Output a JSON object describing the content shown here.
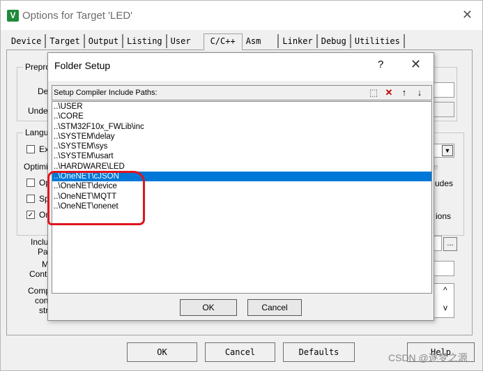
{
  "window": {
    "title": "Options for Target 'LED'",
    "close_glyph": "✕"
  },
  "tabs": [
    "Device",
    "Target",
    "Output",
    "Listing",
    "User",
    "C/C++",
    "Asm",
    "Linker",
    "Debug",
    "Utilities"
  ],
  "active_tab": "C/C++",
  "background_fragments": {
    "prepro": "Prepro",
    "de": "De",
    "unde": "Unde",
    "langu": "Langu",
    "ex": "Ex",
    "optimiz": "Optimiz",
    "op": "Op",
    "sp": "Sp",
    "on": "On",
    "inclu": "Inclu",
    "pa": "Pa",
    "m": "M",
    "contr": "Contr",
    "comp": "Comp",
    "con": "con",
    "str": "str",
    "udes": "udes",
    "ions": "ions",
    "e": "e",
    "ellipsis": "..."
  },
  "checkboxes": {
    "ex": false,
    "op": false,
    "sp": false,
    "on": true
  },
  "bottom_buttons": {
    "ok": "OK",
    "cancel": "Cancel",
    "defaults": "Defaults",
    "help": "Help"
  },
  "watermark": "CSDN @逐梦之源",
  "dialog": {
    "title": "Folder Setup",
    "help": "?",
    "close": "✕",
    "list_header": "Setup Compiler Include Paths:",
    "toolbar": {
      "new": "⬚",
      "delete": "✕",
      "up": "↑",
      "down": "↓"
    },
    "paths": [
      "..\\USER",
      "..\\CORE",
      "..\\STM32F10x_FWLib\\inc",
      "..\\SYSTEM\\delay",
      "..\\SYSTEM\\sys",
      "..\\SYSTEM\\usart",
      "..\\HARDWARE\\LED",
      "..\\OneNET\\cJSON",
      "..\\OneNET\\device",
      "..\\OneNET\\MQTT",
      "..\\OneNET\\onenet"
    ],
    "selected_index": 7,
    "ok": "OK",
    "cancel": "Cancel"
  },
  "colors": {
    "selection": "#0078d7",
    "annotation_red": "#e0141e",
    "app_icon": "#1f8a3a"
  }
}
